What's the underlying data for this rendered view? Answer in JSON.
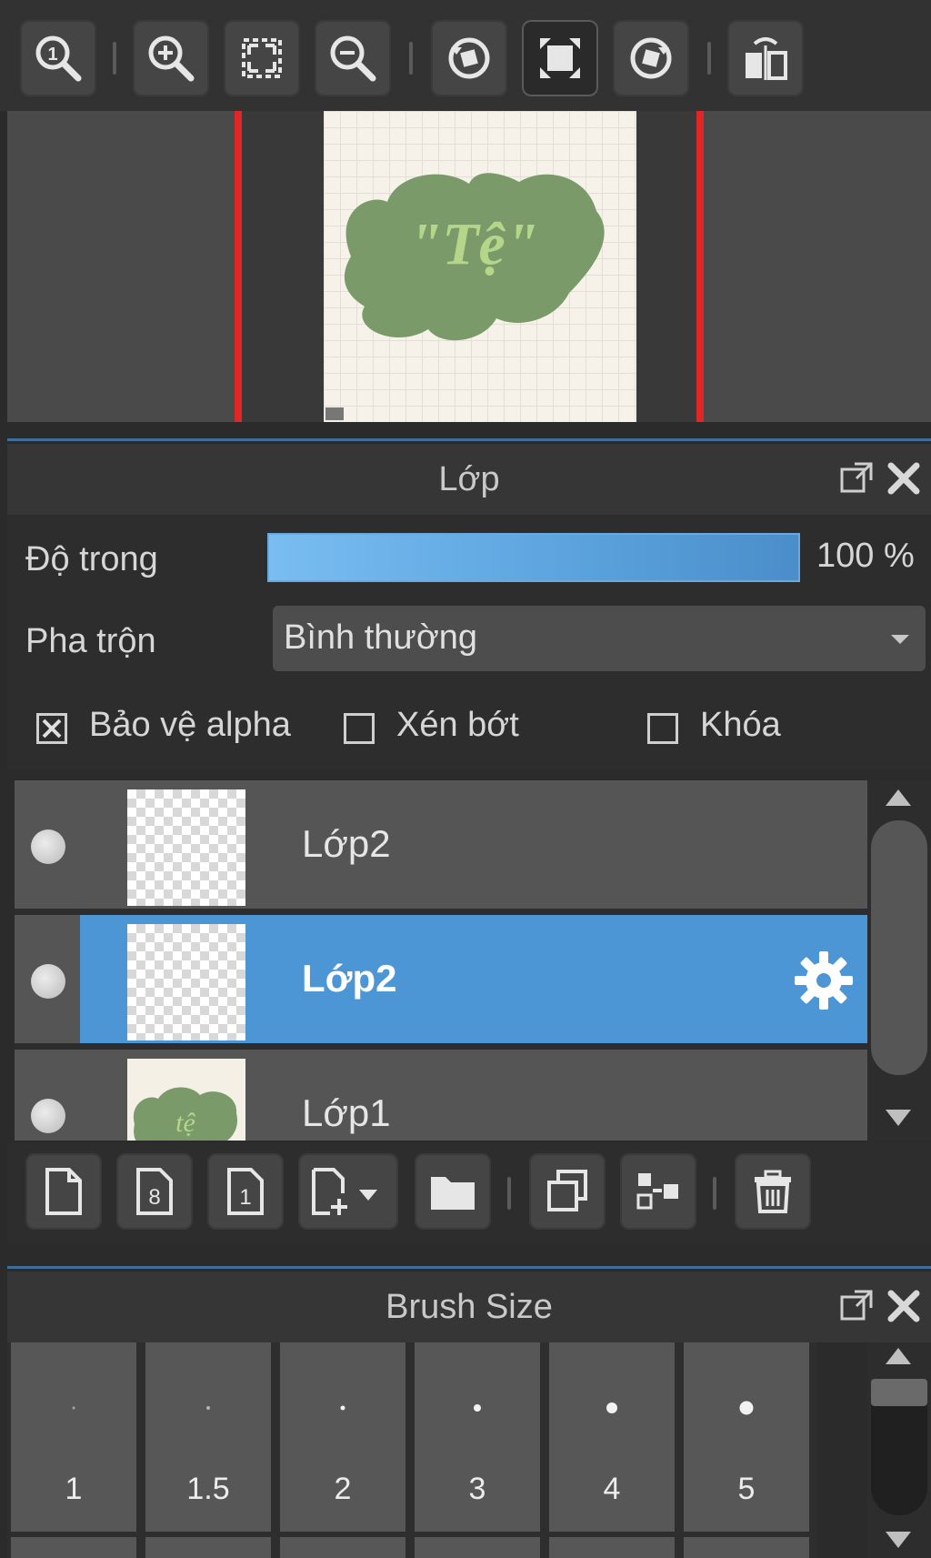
{
  "navigator": {
    "toolbar": [
      {
        "name": "zoom-actual-icon",
        "id": "zoom-actual"
      },
      {
        "name": "zoom-in-icon",
        "id": "zoom-in"
      },
      {
        "name": "zoom-fit-icon",
        "id": "zoom-fit"
      },
      {
        "name": "zoom-out-icon",
        "id": "zoom-out"
      },
      {
        "name": "rotate-left-icon",
        "id": "rotate-left"
      },
      {
        "name": "fit-window-icon",
        "id": "fit-window"
      },
      {
        "name": "rotate-right-icon",
        "id": "rotate-right"
      },
      {
        "name": "flip-horizontal-icon",
        "id": "flip-horizontal"
      }
    ],
    "preview_text": "\"Tệ\"",
    "colors": {
      "frame_border": "#e02626",
      "blob": "#7a9a6a",
      "lettering": "#b5d68a"
    }
  },
  "layer_panel": {
    "title": "Lớp",
    "opacity": {
      "label": "Độ trong",
      "value_text": "100 %",
      "value": 1.0
    },
    "blend": {
      "label": "Pha trộn",
      "value": "Bình thường"
    },
    "checkboxes": [
      {
        "label": "Bảo vệ alpha",
        "checked": true
      },
      {
        "label": "Xén bớt",
        "checked": false
      },
      {
        "label": "Khóa",
        "checked": false
      }
    ],
    "layers": [
      {
        "name": "Lớp2",
        "selected": false,
        "visible": true
      },
      {
        "name": "Lớp2",
        "selected": true,
        "visible": true
      },
      {
        "name": "Lớp1",
        "selected": false,
        "visible": true
      }
    ],
    "toolbar": [
      {
        "name": "new-layer-icon"
      },
      {
        "name": "new-8bit-layer-icon"
      },
      {
        "name": "new-1bit-layer-icon"
      },
      {
        "name": "add-layer-dropdown-icon"
      },
      {
        "name": "new-folder-icon"
      },
      {
        "name": "duplicate-layer-icon"
      },
      {
        "name": "merge-layer-icon"
      },
      {
        "name": "delete-layer-icon"
      }
    ],
    "accent_color": "#4d96d6"
  },
  "brush_panel": {
    "title": "Brush Size",
    "sizes": [
      "1",
      "1.5",
      "2",
      "3",
      "4",
      "5"
    ]
  }
}
